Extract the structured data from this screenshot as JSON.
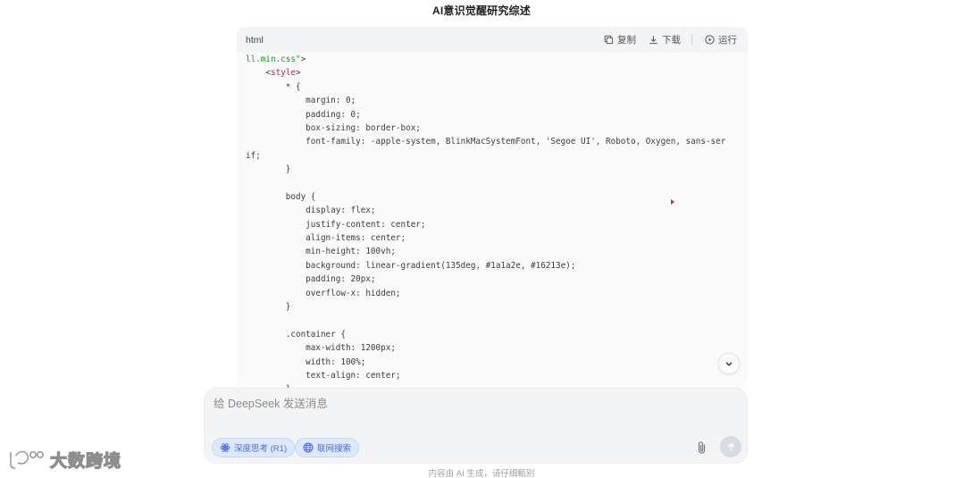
{
  "page": {
    "title": "AI意识觉醒研究综述"
  },
  "code_block": {
    "language": "html",
    "actions": {
      "copy": "复制",
      "download": "下载",
      "run": "运行"
    },
    "lines": [
      [
        {
          "t": "ll.min.css\"",
          "c": "str"
        },
        {
          "t": ">",
          "c": "punct"
        }
      ],
      [
        {
          "t": "    <",
          "c": "punct"
        },
        {
          "t": "style",
          "c": "tag"
        },
        {
          "t": ">",
          "c": "punct"
        }
      ],
      [
        {
          "t": "        * {",
          "c": "punct"
        }
      ],
      [
        {
          "t": "            margin: 0;",
          "c": "punct"
        }
      ],
      [
        {
          "t": "            padding: 0;",
          "c": "punct"
        }
      ],
      [
        {
          "t": "            box-sizing: border-box;",
          "c": "punct"
        }
      ],
      [
        {
          "t": "            font-family: -apple-system, BlinkMacSystemFont, 'Segoe UI', Roboto, Oxygen, sans-ser",
          "c": "punct"
        }
      ],
      [
        {
          "t": "if;",
          "c": "punct"
        }
      ],
      [
        {
          "t": "        }",
          "c": "punct"
        }
      ],
      [
        {
          "t": "",
          "c": "punct"
        }
      ],
      [
        {
          "t": "        body {",
          "c": "punct"
        }
      ],
      [
        {
          "t": "            display: flex;",
          "c": "punct"
        }
      ],
      [
        {
          "t": "            justify-content: center;",
          "c": "punct"
        }
      ],
      [
        {
          "t": "            align-items: center;",
          "c": "punct"
        }
      ],
      [
        {
          "t": "            min-height: 100vh;",
          "c": "punct"
        }
      ],
      [
        {
          "t": "            background: linear-gradient(135deg, #1a1a2e, #16213e);",
          "c": "punct"
        }
      ],
      [
        {
          "t": "            padding: 20px;",
          "c": "punct"
        }
      ],
      [
        {
          "t": "            overflow-x: hidden;",
          "c": "punct"
        }
      ],
      [
        {
          "t": "        }",
          "c": "punct"
        }
      ],
      [
        {
          "t": "",
          "c": "punct"
        }
      ],
      [
        {
          "t": "        .container {",
          "c": "punct"
        }
      ],
      [
        {
          "t": "            max-width: 1200px;",
          "c": "punct"
        }
      ],
      [
        {
          "t": "            width: 100%;",
          "c": "punct"
        }
      ],
      [
        {
          "t": "            text-align: center;",
          "c": "punct"
        }
      ],
      [
        {
          "t": "        }",
          "c": "punct"
        }
      ]
    ]
  },
  "composer": {
    "placeholder": "给 DeepSeek 发送消息",
    "deep_think_label": "深度思考 (R1)",
    "web_search_label": "联网搜索"
  },
  "footer": {
    "note": "内容由 AI 生成，请仔细甄别"
  },
  "watermark": {
    "text": "大数跨境"
  },
  "colors": {
    "accent": "#4d6bfe",
    "chip_bg": "#dbe8fd",
    "composer_bg": "#f3f4f6",
    "string": "#2f8f2f",
    "tag": "#b3285d"
  },
  "icons": [
    "copy-icon",
    "download-icon",
    "run-icon",
    "chevron-down-icon",
    "atom-icon",
    "globe-icon",
    "paperclip-icon",
    "arrow-up-icon"
  ]
}
